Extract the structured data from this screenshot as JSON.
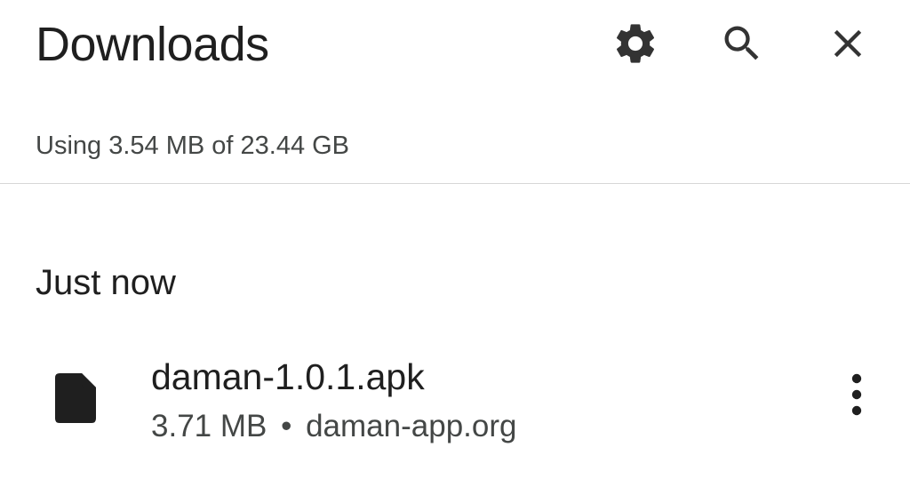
{
  "header": {
    "title": "Downloads",
    "actions": [
      {
        "name": "settings",
        "icon": "gear-icon"
      },
      {
        "name": "search",
        "icon": "search-icon"
      },
      {
        "name": "close",
        "icon": "close-icon"
      }
    ]
  },
  "storage": {
    "text": "Using 3.54 MB of 23.44 GB"
  },
  "sections": [
    {
      "label": "Just now",
      "items": [
        {
          "icon": "file-icon",
          "name": "daman-1.0.1.apk",
          "size": "3.71 MB",
          "separator": "•",
          "source": "daman-app.org",
          "menu_icon": "more-vert-icon"
        }
      ]
    }
  ],
  "colors": {
    "primary_text": "#1f1f1f",
    "secondary_text": "#444746",
    "icon": "#333333",
    "divider": "#d7d7d7",
    "background": "#ffffff"
  }
}
